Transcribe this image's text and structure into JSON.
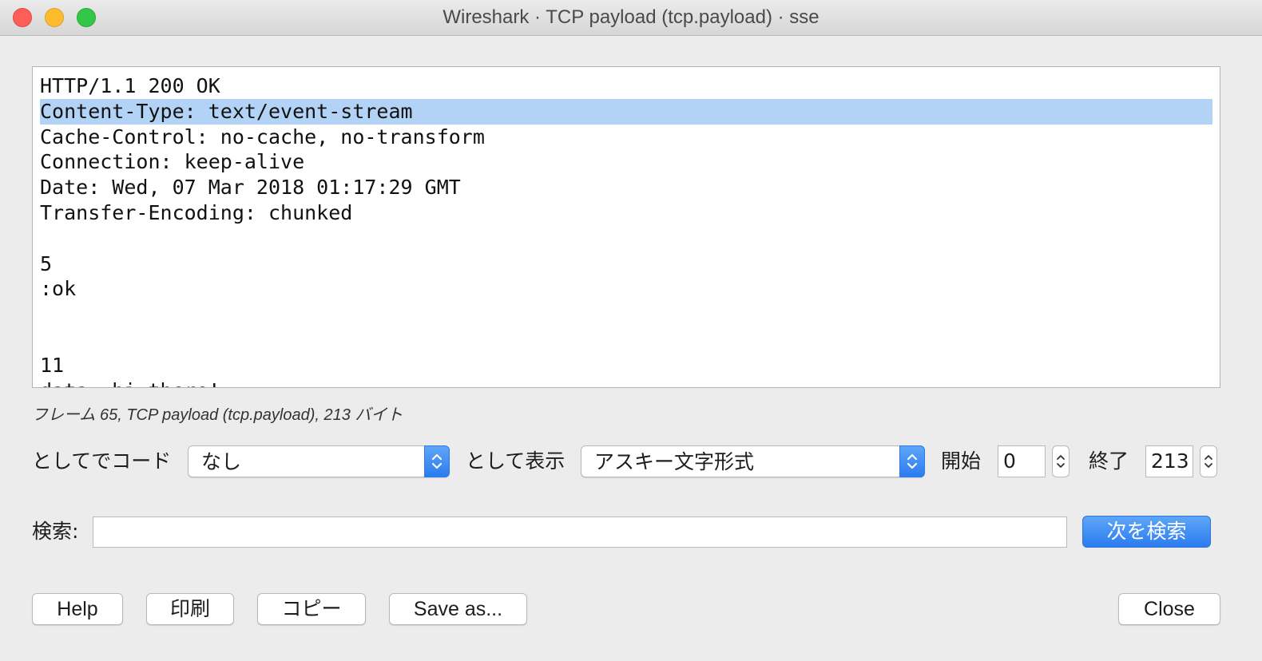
{
  "window": {
    "title": "Wireshark · TCP payload (tcp.payload) · sse"
  },
  "payload": {
    "lines": [
      "HTTP/1.1 200 OK",
      "Content-Type: text/event-stream",
      "Cache-Control: no-cache, no-transform",
      "Connection: keep-alive",
      "Date: Wed, 07 Mar 2018 01:17:29 GMT",
      "Transfer-Encoding: chunked",
      "",
      "5",
      ":ok",
      "",
      "",
      "11",
      "data: hi there!"
    ],
    "selected_line_index": 1
  },
  "frame_info": "フレーム 65, TCP payload (tcp.payload), 213 バイト",
  "controls": {
    "decode_as_label": "としてでコード",
    "decode_as_value": "なし",
    "show_as_label": "として表示",
    "show_as_value": "アスキー文字形式",
    "start_label": "開始",
    "start_value": "0",
    "end_label": "終了",
    "end_value": "213"
  },
  "search": {
    "label": "検索:",
    "value": "",
    "find_next_label": "次を検索"
  },
  "buttons": {
    "help": "Help",
    "print": "印刷",
    "copy": "コピー",
    "save_as": "Save as...",
    "close": "Close"
  },
  "colors": {
    "selection": "#b3d3f6",
    "accent": "#2b7cf0"
  }
}
